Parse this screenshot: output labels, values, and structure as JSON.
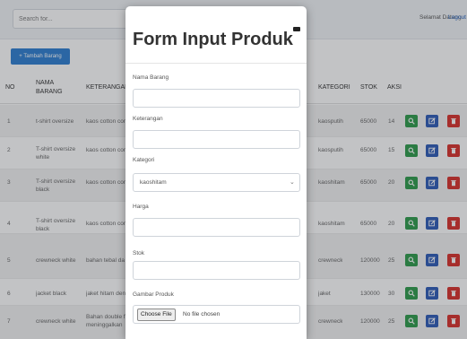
{
  "header": {
    "search_placeholder": "Search for...",
    "greeting": "Selamat Datang",
    "logout": "Logout"
  },
  "toolbar": {
    "add_label": "+ Tambah Barang"
  },
  "table": {
    "columns": {
      "no": "NO",
      "nama": "NAMA BARANG",
      "keterangan": "KETERANGAN",
      "kategori": "KATEGORI",
      "stok": "STOK",
      "aksi": "AKSI"
    },
    "rows": [
      {
        "no": "1",
        "nama": "t-shirt oversize",
        "ket": "kaos cotton com",
        "kategori": "kaosputih",
        "stok": "65000",
        "extra": "14"
      },
      {
        "no": "2",
        "nama": "T-shirt oversize white",
        "ket": "kaos cotton com",
        "kategori": "kaosputih",
        "stok": "65000",
        "extra": "15"
      },
      {
        "no": "3",
        "nama": "T-shirt oversize black",
        "ket": "kaos cotton com",
        "kategori": "kaoshitam",
        "stok": "65000",
        "extra": "20"
      },
      {
        "no": "4",
        "nama": "T-shirt oversize black",
        "ket": "kaos cotton com",
        "kategori": "kaoshitam",
        "stok": "65000",
        "extra": "20"
      },
      {
        "no": "5",
        "nama": "crewneck white",
        "ket": "bahan tebal da",
        "kategori": "crewneck",
        "stok": "120000",
        "extra": "25"
      },
      {
        "no": "6",
        "nama": "jacket black",
        "ket": "jaket hitam den",
        "kategori": "jaket",
        "stok": "130000",
        "extra": "30"
      },
      {
        "no": "7",
        "nama": "crewneck white",
        "ket": "Bahan double f meninggalkan",
        "kategori": "crewneck",
        "stok": "120000",
        "extra": "25"
      }
    ]
  },
  "modal": {
    "title": "Form Input Produk",
    "fields": {
      "nama": {
        "label": "Nama Barang",
        "value": ""
      },
      "keterangan": {
        "label": "Keterangan",
        "value": ""
      },
      "kategori": {
        "label": "Kategori",
        "selected": "kaoshitam"
      },
      "harga": {
        "label": "Harga",
        "value": ""
      },
      "stok": {
        "label": "Stok",
        "value": ""
      },
      "gambar": {
        "label": "Gambar Produk",
        "button": "Choose File",
        "status": "No file chosen"
      }
    }
  },
  "icons": {
    "view": "search-icon",
    "edit": "edit-icon",
    "delete": "trash-icon",
    "select": "chevron-down-icon",
    "close": "close-icon"
  },
  "colors": {
    "view": "#2e9b4b",
    "edit": "#2f5cb8",
    "delete": "#d9312b",
    "primary": "#2f7fd1"
  }
}
